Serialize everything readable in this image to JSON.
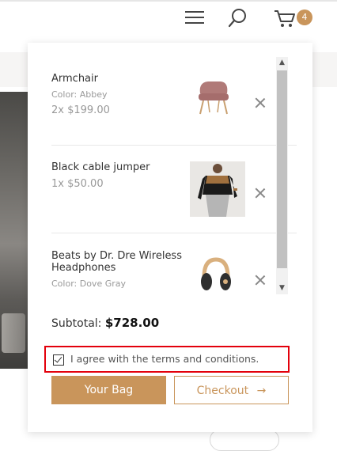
{
  "theme": {
    "accent": "#c9955b",
    "highlight": "#e3000b"
  },
  "header": {
    "icons": [
      "menu-icon",
      "search-icon",
      "cart-icon"
    ],
    "cart_count": "4"
  },
  "cart": {
    "items": [
      {
        "name": "Armchair",
        "meta": "Color: Abbey",
        "qty": "2x $199.00"
      },
      {
        "name": "Black cable jumper",
        "meta": "",
        "qty": "1x $50.00"
      },
      {
        "name": "Beats by Dr. Dre Wireless Headphones",
        "meta": "Color: Dove Gray",
        "qty": ""
      }
    ],
    "subtotal_label": "Subtotal:",
    "subtotal_value": "$728.00",
    "terms_label": "I agree with the terms and conditions.",
    "terms_checked": true,
    "bag_button": "Your Bag",
    "checkout_button": "Checkout",
    "checkout_arrow": "→",
    "scroll_up": "▲",
    "scroll_down": "▼"
  }
}
